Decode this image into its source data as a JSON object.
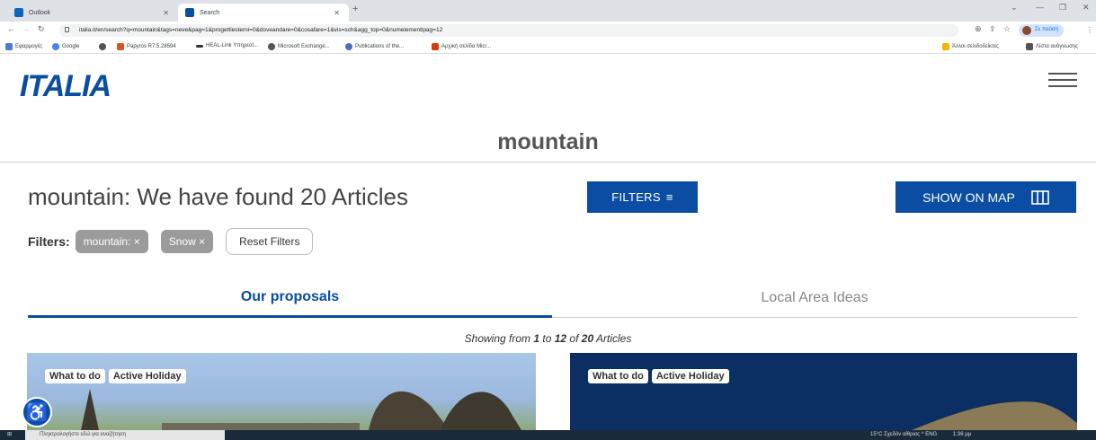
{
  "browser": {
    "tabs": [
      {
        "title": "Outlook",
        "active": false,
        "color": "#0a64c0"
      },
      {
        "title": "Search",
        "active": true,
        "color": "#0a4da2"
      }
    ],
    "url": "italia.it/en/search?q=mountain&tags=neve&pag=1&progettiesterni=0&doveandare=0&cosafare=1&vis=sch&agg_top=0&numelementipag=12",
    "profile_label": "Σε παύση",
    "bookmarks": [
      {
        "label": "Εφαρμογές",
        "color": "#4a7ad6"
      },
      {
        "label": "Google",
        "color": "#4285f4"
      },
      {
        "label": "",
        "color": "#555"
      },
      {
        "label": "Papyros R7.5.28594",
        "color": "#d9531e"
      },
      {
        "label": "HEAL-Link Υπηρεσί...",
        "color": "#333"
      },
      {
        "label": "Microsoft Exchange...",
        "color": "#555"
      },
      {
        "label": "Publications of the...",
        "color": "#4c6fbf"
      },
      {
        "label": "Αρχική σελίδα Micr...",
        "color": "#d83b01"
      }
    ],
    "bookmarks_right": [
      {
        "label": "Άλλοι σελιδοδείκτες",
        "color": "#f5b400"
      },
      {
        "label": "Λίστα ανάγνωσης",
        "color": "#555"
      }
    ]
  },
  "site": {
    "logo_text": "ITALIA",
    "search_term": "mountain",
    "results_title": "mountain: We have found 20 Articles",
    "filters_button": "FILTERS",
    "map_button": "SHOW ON MAP",
    "filters_label": "Filters:",
    "active_filters": [
      "mountain: ×",
      "Snow ×"
    ],
    "reset_button": "Reset Filters",
    "tabs": [
      "Our proposals",
      "Local Area Ideas"
    ],
    "showing_prefix": "Showing from ",
    "showing_from": "1",
    "showing_to_label": " to ",
    "showing_to": "12",
    "showing_of_label": " of ",
    "showing_total": "20",
    "showing_suffix": " Articles",
    "cards": [
      {
        "tags": [
          "What to do",
          "Active Holiday"
        ]
      },
      {
        "tags": [
          "What to do",
          "Active Holiday"
        ]
      }
    ],
    "brand_color": "#0a4da2"
  },
  "taskbar": {
    "search_placeholder": "Πληκτρολογήστε εδώ για αναζήτηση",
    "tray_text": "15°C  Σχεδόν αίθριος   ^  ENG",
    "time": "1:36 μμ"
  }
}
